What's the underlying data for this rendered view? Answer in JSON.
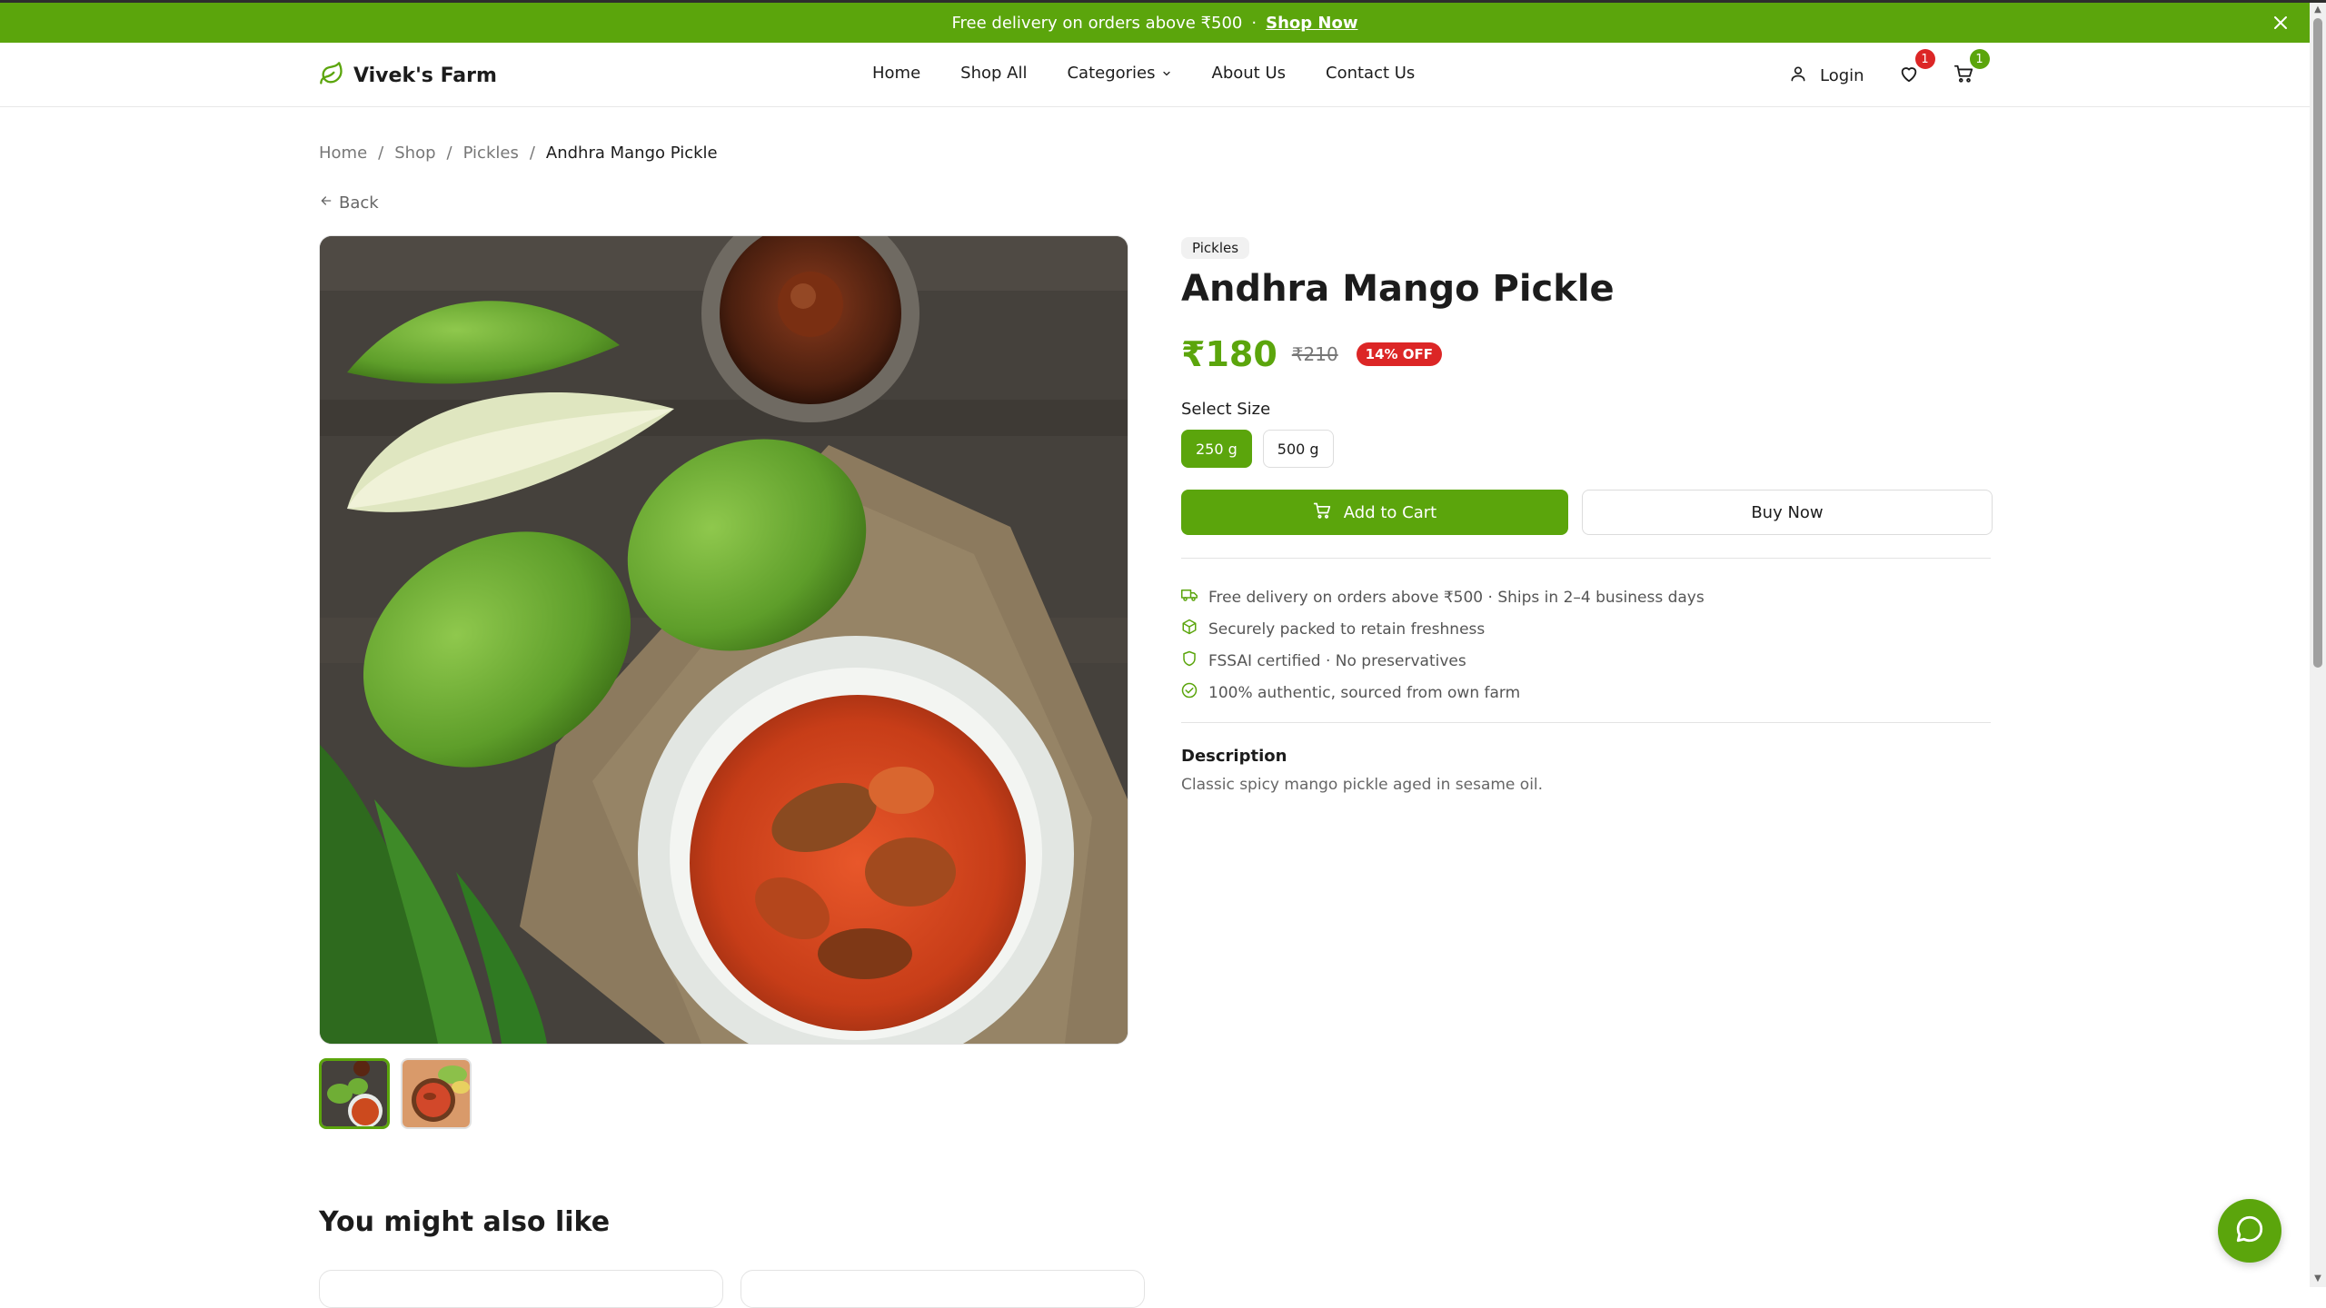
{
  "announcement": {
    "text": "Free delivery on orders above ₹500",
    "separator": "·",
    "link_label": "Shop Now",
    "close_icon": "close-icon"
  },
  "brand": {
    "name": "Vivek's Farm",
    "logo_icon": "leaf-icon"
  },
  "nav": {
    "items": [
      {
        "label": "Home"
      },
      {
        "label": "Shop All"
      },
      {
        "label": "Categories"
      },
      {
        "label": "About Us"
      },
      {
        "label": "Contact Us"
      }
    ]
  },
  "header_actions": {
    "login_label": "Login",
    "wishlist_count": "1",
    "cart_count": "1"
  },
  "breadcrumb": {
    "items": [
      "Home",
      "Shop",
      "Pickles",
      "Andhra Mango Pickle"
    ],
    "separator": "/"
  },
  "back_label": "Back",
  "product": {
    "category": "Pickles",
    "title": "Andhra Mango Pickle",
    "price": "₹180",
    "original_price": "₹210",
    "discount": "14% OFF",
    "size_label": "Select Size",
    "sizes": [
      {
        "label": "250 g",
        "selected": true
      },
      {
        "label": "500 g",
        "selected": false
      }
    ],
    "add_to_cart_label": "Add to Cart",
    "buy_now_label": "Buy Now",
    "features": [
      {
        "icon": "truck-icon",
        "text": "Free delivery on orders above ₹500 · Ships in 2–4 business days"
      },
      {
        "icon": "package-icon",
        "text": "Securely packed to retain freshness"
      },
      {
        "icon": "shield-icon",
        "text": "FSSAI certified · No preservatives"
      },
      {
        "icon": "check-circle-icon",
        "text": "100% authentic, sourced from own farm"
      }
    ],
    "description_heading": "Description",
    "description": "Classic spicy mango pickle aged in sesame oil."
  },
  "related": {
    "heading": "You might also like"
  },
  "colors": {
    "brand_green": "#5ba50c",
    "badge_red": "#dc2626",
    "text": "#1c1c1c",
    "muted": "#777777"
  }
}
